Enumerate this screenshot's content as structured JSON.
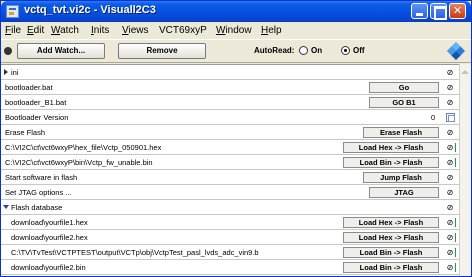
{
  "window": {
    "title": "vctq_tvt.vi2c - Visuall2C3"
  },
  "menu": [
    "File",
    "Edit",
    "Watch",
    "Inits",
    "Views",
    "VCT69xyP",
    "Window",
    "Help"
  ],
  "menu_underline": [
    "F",
    "E",
    "W",
    "I",
    "V",
    "",
    "W",
    "H"
  ],
  "toolbar": {
    "add_watch": "Add Watch...",
    "remove": "Remove",
    "autoread_label": "AutoRead:",
    "on_label": "On",
    "off_label": "Off",
    "autoread_selected": "Off"
  },
  "rows": [
    {
      "label": "ini",
      "kind": "group-collapsed",
      "end": "⊘"
    },
    {
      "label": "bootloader.bat",
      "button": "Go",
      "end": "⊘"
    },
    {
      "label": "bootloader_B1.bat",
      "button": "GO B1",
      "end": "⊘"
    },
    {
      "label": "Bootloader Version",
      "value": "0",
      "end": "check"
    },
    {
      "label": "Erase Flash",
      "button": "Erase Flash",
      "end": "⊘"
    },
    {
      "label": "C:\\VI2C\\ct\\vct6wxyP\\hex_file\\Vctp_050901.hex",
      "button": "Load Hex -> Flash",
      "end": "⊘",
      "marker": true
    },
    {
      "label": "C:\\VI2C\\ct\\vct6wxyP\\bin\\Vctp_fw_unable.bin",
      "button": "Load Bin -> Flash",
      "end": "⊘",
      "marker": true
    },
    {
      "label": "Start software in flash",
      "button": "Jump Flash",
      "end": "⊘"
    },
    {
      "label": "Set JTAG options ...",
      "button": "JTAG",
      "end": "⊘"
    },
    {
      "label": "Flash database",
      "kind": "group-expanded",
      "end": "⊘"
    },
    {
      "label": "download\\yourfile1.hex",
      "button": "Load Hex -> Flash",
      "end": "⊘",
      "marker": true,
      "indent": true
    },
    {
      "label": "download\\yourfile2.hex",
      "button": "Load Hex -> Flash",
      "end": "⊘",
      "marker": true,
      "indent": true
    },
    {
      "label": "C:\\TV\\TvTest\\VCTPTEST\\output\\VCTp\\obj\\VctpTest_pasl_lvds_adc_vin9.b",
      "button": "Load Bin -> Flash",
      "end": "⊘",
      "marker": true,
      "indent": true
    },
    {
      "label": "download\\yourfile2.bin",
      "button": "Load Bin -> Flash",
      "end": "⊘",
      "marker": true,
      "indent": true
    }
  ],
  "icons": {
    "title": "app-window-icon",
    "toolbar_right": "diamond-icon",
    "no_entry": "⊘"
  },
  "colors": {
    "titlebar": "#0650e0",
    "window_bg": "#ece9d8",
    "panel_bg": "#ffffff",
    "marker": "#0aa83a"
  }
}
